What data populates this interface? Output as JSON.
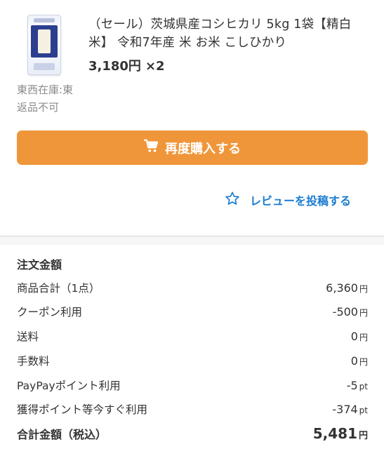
{
  "product": {
    "title": "（セール）茨城県産コシヒカリ 5kg 1袋【精白米】 令和7年産 米 お米 こしひかり",
    "image_icon": "rice-bag-image",
    "price": "3,180円",
    "quantity": "×2",
    "warehouse": "東西在庫:東",
    "return_policy": "返品不可"
  },
  "actions": {
    "rebuy_label": "再度購入する",
    "rebuy_icon": "cart-icon",
    "review_label": "レビューを投稿する",
    "review_icon": "star-outline-icon"
  },
  "summary": {
    "title": "注文金額",
    "rows": [
      {
        "label": "商品合計（1点）",
        "value": "6,360",
        "unit": "円"
      },
      {
        "label": "クーポン利用",
        "value": "-500",
        "unit": "円"
      },
      {
        "label": "送料",
        "value": "0",
        "unit": "円"
      },
      {
        "label": "手数料",
        "value": "0",
        "unit": "円"
      },
      {
        "label": "PayPayポイント利用",
        "value": "-5",
        "unit": "pt"
      },
      {
        "label": "獲得ポイント等今すぐ利用",
        "value": "-374",
        "unit": "pt"
      }
    ],
    "total": {
      "label": "合計金額（税込）",
      "value": "5,481",
      "unit": "円"
    }
  },
  "colors": {
    "button_bg": "#f0963a",
    "link": "#1a7bd1",
    "muted_text": "#8a8a8a"
  }
}
